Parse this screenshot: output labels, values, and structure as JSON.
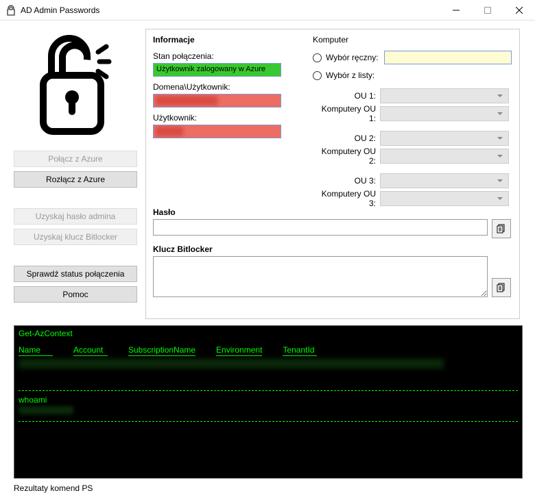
{
  "window": {
    "title": "AD Admin Passwords"
  },
  "sidebar": {
    "connect": "Połącz z Azure",
    "disconnect": "Rozłącz z Azure",
    "get_admin_pw": "Uzyskaj hasło admina",
    "get_bitlocker": "Uzyskaj klucz Bitlocker",
    "check_status": "Sprawdź status połączenia",
    "help": "Pomoc"
  },
  "info": {
    "title": "Informacje",
    "conn_state_label": "Stan połączenia:",
    "conn_state_value": "Użytkownik zalogowany w Azure",
    "domain_user_label": "Domena\\Użytkownik:",
    "user_label": "Użytkownik:"
  },
  "komputer": {
    "title": "Komputer",
    "manual_choice": "Wybór ręczny:",
    "list_choice": "Wybór z listy:",
    "ou1": "OU 1:",
    "comp_ou1": "Komputery OU 1:",
    "ou2": "OU 2:",
    "comp_ou2": "Komputery OU 2:",
    "ou3": "OU 3:",
    "comp_ou3": "Komputery OU 3:"
  },
  "haslo": {
    "label": "Hasło"
  },
  "bitlocker": {
    "label": "Klucz Bitlocker"
  },
  "terminal": {
    "cmd1": "Get-AzContext",
    "col1": "Name",
    "col2": "Account",
    "col3": "SubscriptionName",
    "col4": "Environment",
    "col5": "TenantId",
    "cmd2": "whoami"
  },
  "footer": "Rezultaty komend PS"
}
